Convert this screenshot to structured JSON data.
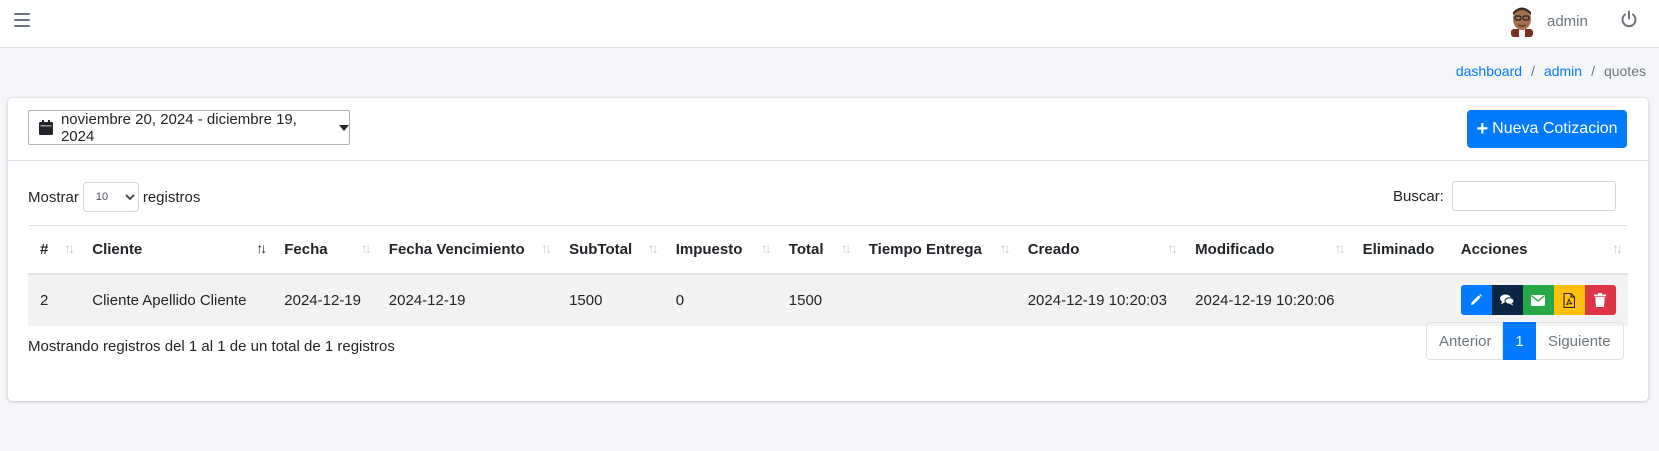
{
  "topbar": {
    "user_name": "admin"
  },
  "breadcrumb": {
    "items": [
      "dashboard",
      "admin"
    ],
    "current": "quotes"
  },
  "toolbar": {
    "date_range": "noviembre 20, 2024 - diciembre 19, 2024",
    "new_button": "Nueva Cotizacion"
  },
  "table_controls": {
    "show_label": "Mostrar",
    "page_size": "10",
    "records_label": "registros",
    "search_label": "Buscar:",
    "search_value": ""
  },
  "table": {
    "columns": [
      "#",
      "Cliente",
      "Fecha",
      "Fecha Vencimiento",
      "SubTotal",
      "Impuesto",
      "Total",
      "Tiempo Entrega",
      "Creado",
      "Modificado",
      "Eliminado",
      "Acciones"
    ],
    "rows": [
      {
        "id": "2",
        "cliente": "Cliente Apellido Cliente",
        "fecha": "2024-12-19",
        "vencimiento": "2024-12-19",
        "subtotal": "1500",
        "impuesto": "0",
        "total": "1500",
        "tiempo": "",
        "creado": "2024-12-19 10:20:03",
        "modificado": "2024-12-19 10:20:06",
        "eliminado": ""
      }
    ]
  },
  "footer": {
    "info": "Mostrando registros del 1 al 1 de un total de 1 registros",
    "prev": "Anterior",
    "page": "1",
    "next": "Siguiente"
  },
  "colors": {
    "primary": "#007bff",
    "dark": "#0b2545",
    "success": "#28a745",
    "warning": "#ffc107",
    "danger": "#dc3545"
  },
  "icons": [
    "menu-icon",
    "avatar-image",
    "power-icon",
    "calendar-icon",
    "plus-icon",
    "pencil-icon",
    "comments-icon",
    "envelope-icon",
    "pdf-file-icon",
    "trash-icon"
  ]
}
